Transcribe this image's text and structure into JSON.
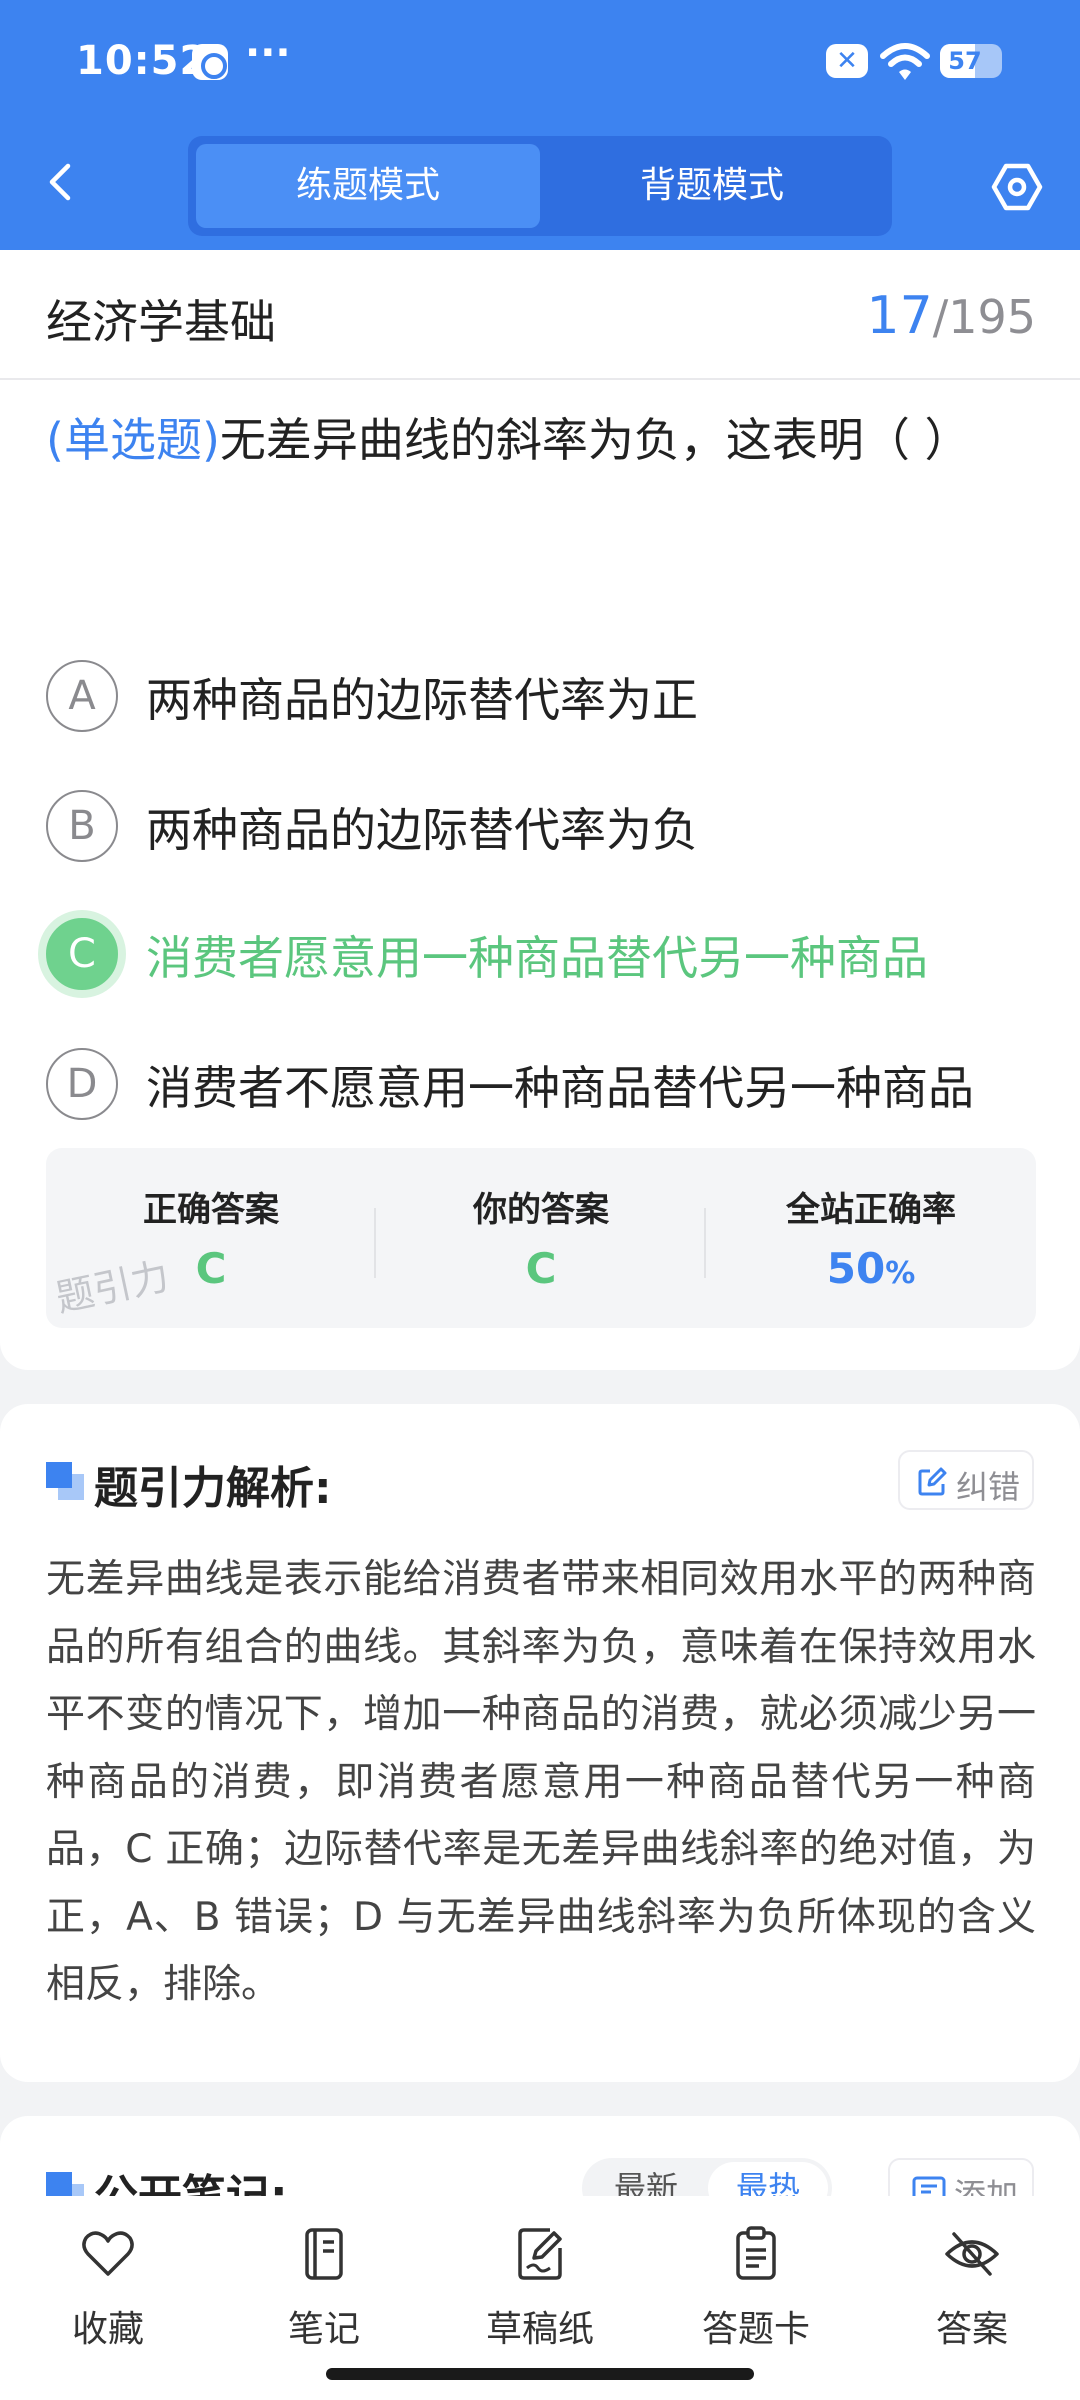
{
  "status_bar": {
    "time": "10:52",
    "more": "···",
    "battery": "57",
    "battery_level": 0.57
  },
  "header": {
    "tabs": [
      {
        "label": "练题模式",
        "active": true
      },
      {
        "label": "背题模式",
        "active": false
      }
    ]
  },
  "subject": {
    "name": "经济学基础",
    "current": "17",
    "separator": "/",
    "total": "195"
  },
  "question": {
    "type": "(单选题)",
    "text": "无差异曲线的斜率为负，这表明（ ）",
    "options": [
      {
        "letter": "A",
        "text": "两种商品的边际替代率为正",
        "state": "normal"
      },
      {
        "letter": "B",
        "text": "两种商品的边际替代率为负",
        "state": "normal"
      },
      {
        "letter": "C",
        "text": "消费者愿意用一种商品替代另一种商品",
        "state": "correct"
      },
      {
        "letter": "D",
        "text": "消费者不愿意用一种商品替代另一种商品",
        "state": "normal"
      }
    ]
  },
  "result": {
    "correct_label": "正确答案",
    "correct_value": "C",
    "yours_label": "你的答案",
    "yours_value": "C",
    "rate_label": "全站正确率",
    "rate_value": "50",
    "rate_unit": "%",
    "watermark": "题引力"
  },
  "analysis": {
    "title": "题引力解析:",
    "correct_button": "纠错",
    "text": "无差异曲线是表示能给消费者带来相同效用水平的两种商品的所有组合的曲线。其斜率为负，意味着在保持效用水平不变的情况下，增加一种商品的消费，就必须减少另一种商品的消费，即消费者愿意用一种商品替代另一种商品，C 正确；边际替代率是无差异曲线斜率的绝对值，为正，A、B 错误；D 与无差异曲线斜率为负所体现的含义相反，排除。"
  },
  "notes": {
    "title": "公开笔记:",
    "sort_tabs": [
      "最新",
      "最热"
    ],
    "active_sort": "最热",
    "add_button": "添加"
  },
  "bottom_nav": [
    {
      "label": "收藏",
      "icon": "heart-icon"
    },
    {
      "label": "笔记",
      "icon": "notebook-icon"
    },
    {
      "label": "草稿纸",
      "icon": "draft-paper-icon"
    },
    {
      "label": "答题卡",
      "icon": "answer-sheet-icon"
    },
    {
      "label": "答案",
      "icon": "eye-off-icon"
    }
  ],
  "colors": {
    "primary": "#3d83f0",
    "correct_green": "#5bc67e",
    "background": "#f2f3f5"
  }
}
